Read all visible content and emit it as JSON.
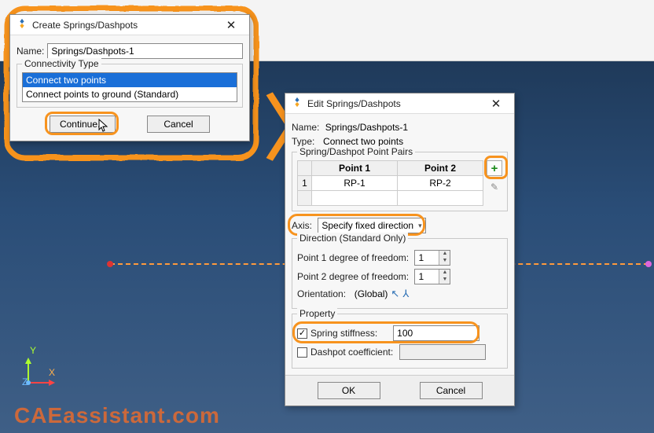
{
  "watermark": "CAEassistant.com",
  "axis": {
    "x": "X",
    "y": "Y",
    "z": "Z"
  },
  "arrow": "〉",
  "dialog1": {
    "title": "Create Springs/Dashpots",
    "name_label": "Name:",
    "name_value": "Springs/Dashpots-1",
    "group_label": "Connectivity Type",
    "options": [
      "Connect two points",
      "Connect points to ground (Standard)"
    ],
    "continue": "Continue...",
    "cancel": "Cancel"
  },
  "dialog2": {
    "title": "Edit Springs/Dashpots",
    "name_label": "Name:",
    "name_value": "Springs/Dashpots-1",
    "type_label": "Type:",
    "type_value": "Connect two points",
    "pairs_label": "Spring/Dashpot Point Pairs",
    "col1": "Point 1",
    "col2": "Point 2",
    "row_idx": "1",
    "p1": "RP-1",
    "p2": "RP-2",
    "axis_label": "Axis:",
    "axis_value": "Specify fixed direction",
    "dir_label": "Direction (Standard Only)",
    "dof1_label": "Point 1 degree of freedom:",
    "dof1_value": "1",
    "dof2_label": "Point 2 degree of freedom:",
    "dof2_value": "1",
    "orient_label": "Orientation:",
    "orient_value": "(Global)",
    "property_label": "Property",
    "stiff_label": "Spring stiffness:",
    "stiff_value": "100",
    "dash_label": "Dashpot coefficient:",
    "dash_value": "",
    "ok": "OK",
    "cancel": "Cancel"
  }
}
